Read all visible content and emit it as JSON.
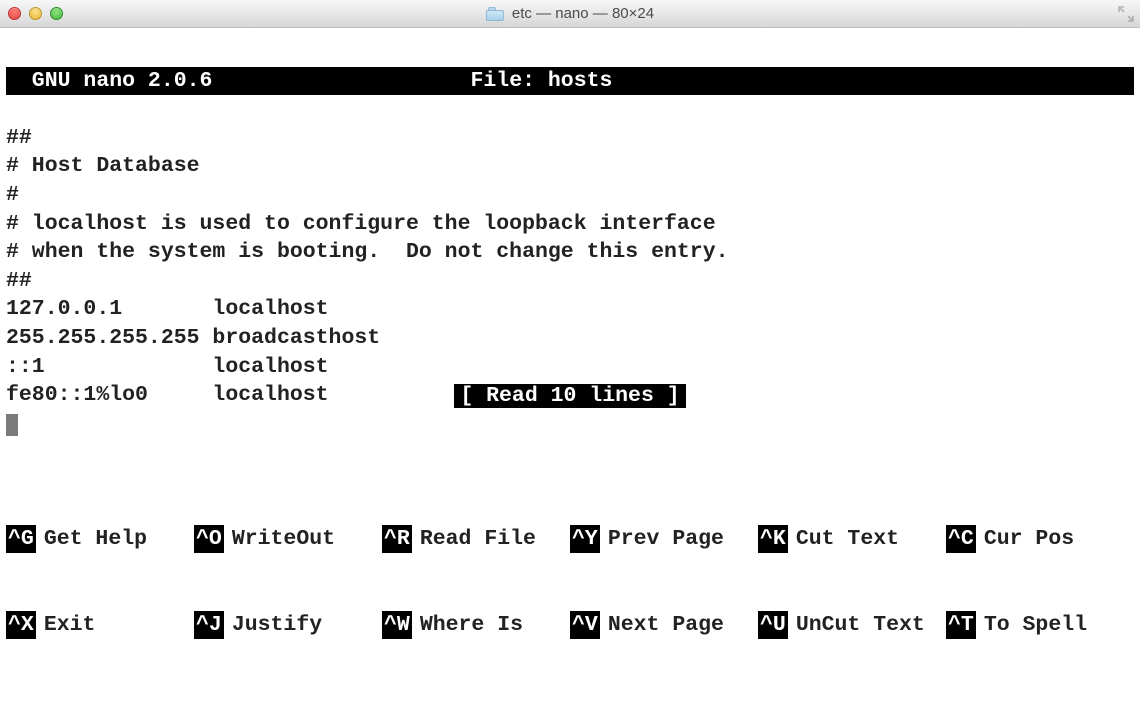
{
  "window": {
    "title": "etc — nano — 80×24"
  },
  "header": {
    "left": "  GNU nano 2.0.6",
    "center": "File: hosts"
  },
  "content_lines": [
    "",
    "##",
    "# Host Database",
    "#",
    "# localhost is used to configure the loopback interface",
    "# when the system is booting.  Do not change this entry.",
    "##",
    "127.0.0.1       localhost",
    "255.255.255.255 broadcasthost",
    "::1             localhost",
    "fe80::1%lo0     localhost"
  ],
  "status": "[ Read 10 lines ]",
  "help": {
    "row1": [
      {
        "key": "^G",
        "label": "Get Help"
      },
      {
        "key": "^O",
        "label": "WriteOut"
      },
      {
        "key": "^R",
        "label": "Read File"
      },
      {
        "key": "^Y",
        "label": "Prev Page"
      },
      {
        "key": "^K",
        "label": "Cut Text"
      },
      {
        "key": "^C",
        "label": "Cur Pos"
      }
    ],
    "row2": [
      {
        "key": "^X",
        "label": "Exit"
      },
      {
        "key": "^J",
        "label": "Justify"
      },
      {
        "key": "^W",
        "label": "Where Is"
      },
      {
        "key": "^V",
        "label": "Next Page"
      },
      {
        "key": "^U",
        "label": "UnCut Text"
      },
      {
        "key": "^T",
        "label": "To Spell"
      }
    ]
  }
}
